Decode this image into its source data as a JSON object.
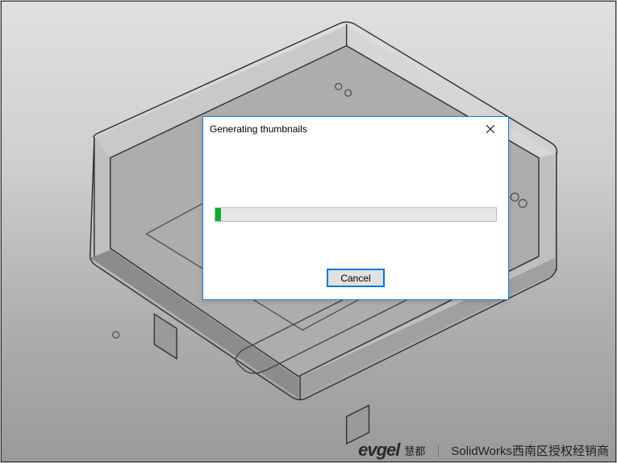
{
  "dialog": {
    "title": "Generating thumbnails",
    "cancel_label": "Cancel",
    "close_icon": "close",
    "progress_percent": 2
  },
  "footer": {
    "brand": "evgel",
    "label_1": "慧都",
    "separator": "｜",
    "label_2": "SolidWorks西南区授权经销商"
  },
  "colors": {
    "dialog_border": "#1a82d6",
    "button_focus": "#0078d7",
    "progress_fill": "#06b025"
  }
}
